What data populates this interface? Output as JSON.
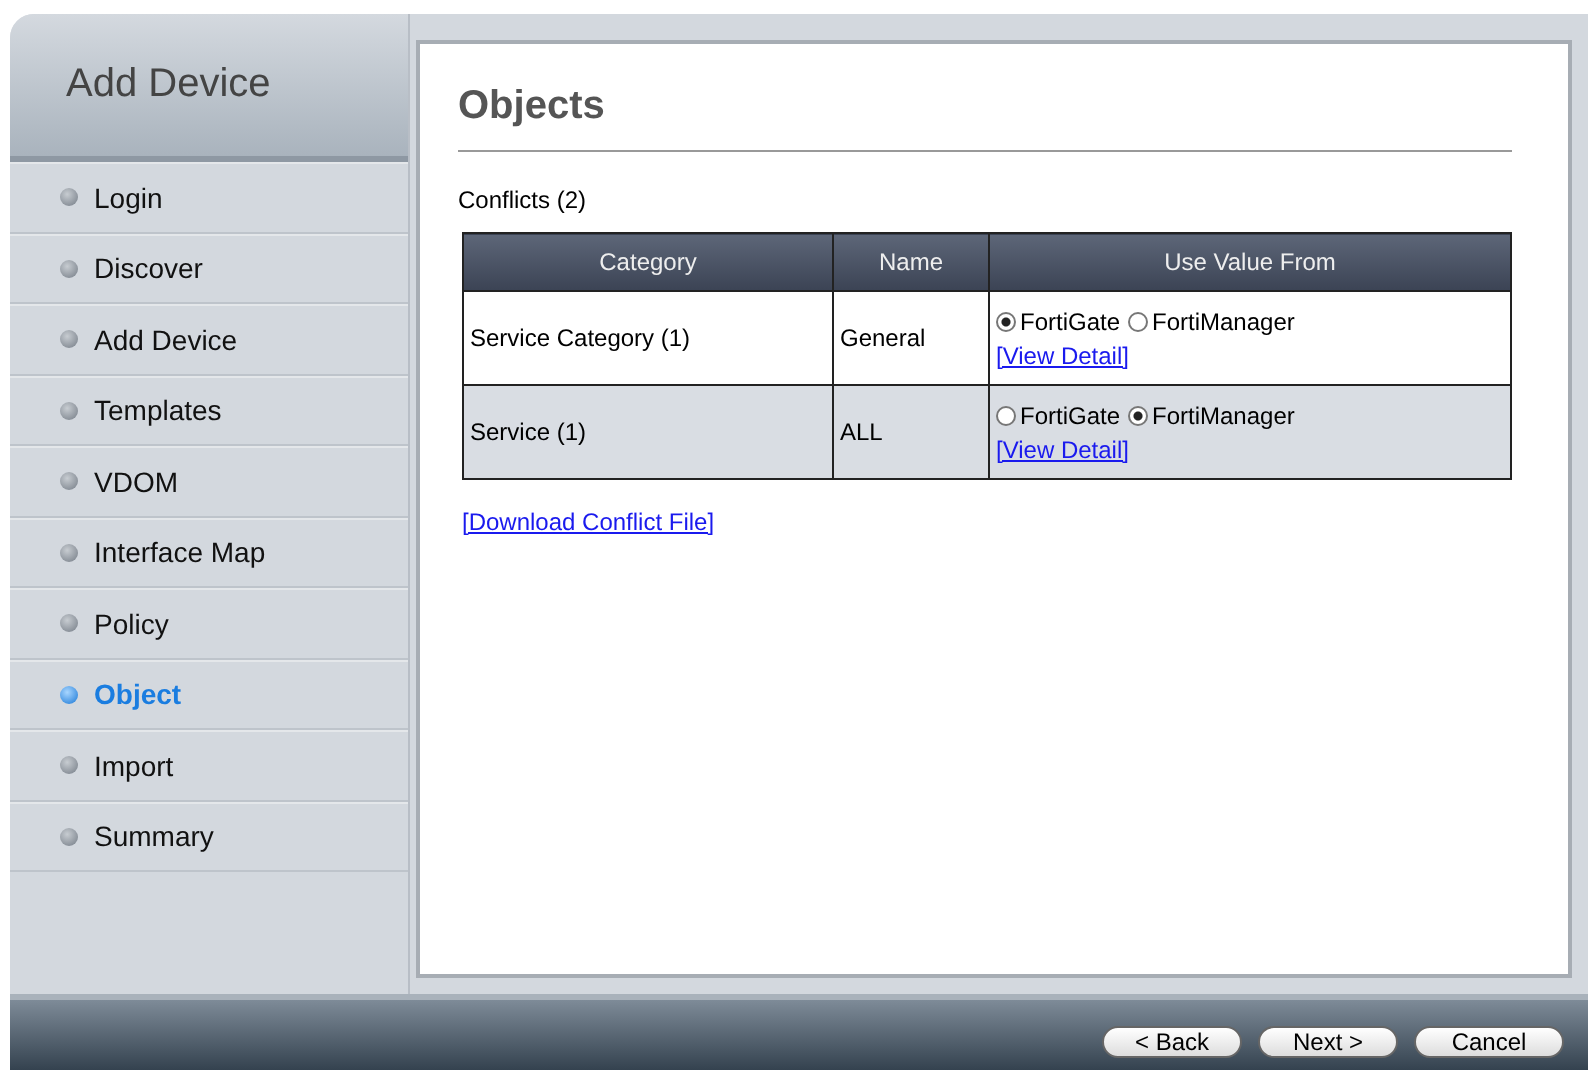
{
  "sidebar": {
    "title": "Add Device",
    "items": [
      {
        "label": "Login",
        "selected": false
      },
      {
        "label": "Discover",
        "selected": false
      },
      {
        "label": "Add Device",
        "selected": false
      },
      {
        "label": "Templates",
        "selected": false
      },
      {
        "label": "VDOM",
        "selected": false
      },
      {
        "label": "Interface Map",
        "selected": false
      },
      {
        "label": "Policy",
        "selected": false
      },
      {
        "label": "Object",
        "selected": true
      },
      {
        "label": "Import",
        "selected": false
      },
      {
        "label": "Summary",
        "selected": false
      }
    ]
  },
  "content": {
    "heading": "Objects",
    "conflicts_label": "Conflicts (2)",
    "table": {
      "columns": [
        "Category",
        "Name",
        "Use Value From"
      ],
      "rows": [
        {
          "category": "Service Category (1)",
          "name": "General",
          "options": [
            {
              "label": "FortiGate",
              "selected": true
            },
            {
              "label": "FortiManager",
              "selected": false
            }
          ],
          "link": "[View Detail]"
        },
        {
          "category": "Service (1)",
          "name": "ALL",
          "options": [
            {
              "label": "FortiGate",
              "selected": false
            },
            {
              "label": "FortiManager",
              "selected": true
            }
          ],
          "link": "[View Detail]"
        }
      ]
    },
    "download_link": "[Download Conflict File]"
  },
  "buttons": [
    "< Back",
    "Next >",
    "Cancel"
  ]
}
